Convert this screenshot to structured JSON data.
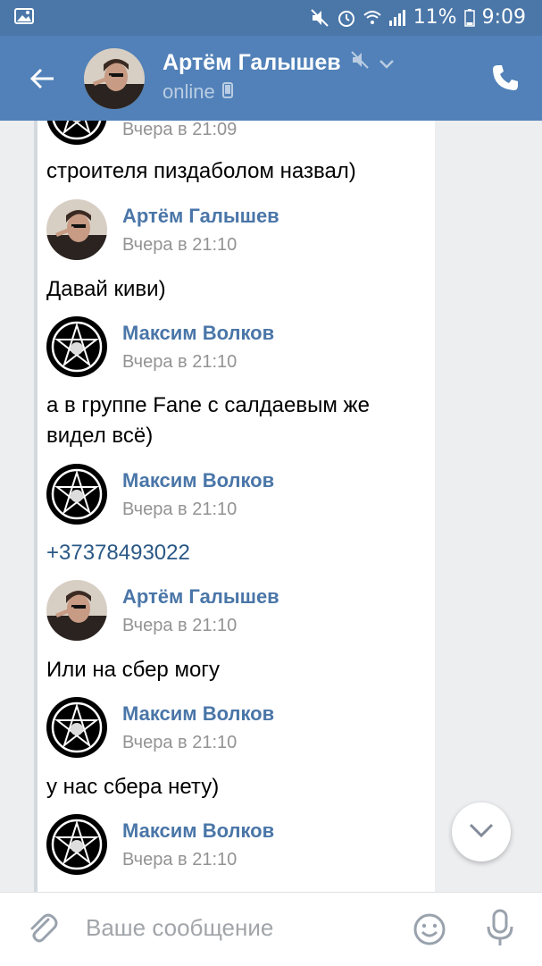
{
  "status_bar": {
    "battery": "11%",
    "time": "9:09"
  },
  "header": {
    "contact_name": "Артём Галышев",
    "status": "online"
  },
  "messages": [
    {
      "type": "time_only",
      "time": "Вчера в 21:09"
    },
    {
      "type": "text",
      "text": "строителя пиздаболом назвал)"
    },
    {
      "type": "author",
      "name": "Артём Галышев",
      "time": "Вчера в 21:10",
      "avatar": "artem"
    },
    {
      "type": "text",
      "text": "Давай киви)"
    },
    {
      "type": "author",
      "name": "Максим Волков",
      "time": "Вчера в 21:10",
      "avatar": "maxim"
    },
    {
      "type": "text",
      "text": "а в группе Fane с салдаевым же видел всё)"
    },
    {
      "type": "author",
      "name": "Максим Волков",
      "time": "Вчера в 21:10",
      "avatar": "maxim"
    },
    {
      "type": "link",
      "text": "+37378493022"
    },
    {
      "type": "author",
      "name": "Артём Галышев",
      "time": "Вчера в 21:10",
      "avatar": "artem"
    },
    {
      "type": "text",
      "text": "Или на сбер могу"
    },
    {
      "type": "author",
      "name": "Максим Волков",
      "time": "Вчера в 21:10",
      "avatar": "maxim"
    },
    {
      "type": "text",
      "text": "у нас сбера нету)"
    },
    {
      "type": "author",
      "name": "Максим Волков",
      "time": "Вчера в 21:10",
      "avatar": "maxim"
    }
  ],
  "composer": {
    "placeholder": "Ваше сообщение"
  },
  "icons": {
    "status_left": "image-icon",
    "back": "back-arrow-icon",
    "mute": "muted-speaker-icon",
    "chevron": "chevron-down-icon",
    "device": "mobile-device-icon",
    "call": "phone-icon",
    "scroll_down": "chevron-down-icon",
    "attach": "paperclip-icon",
    "emoji": "smile-icon",
    "voice": "microphone-icon"
  },
  "colors": {
    "header": "#5181b8",
    "status_bar": "#4a76a8",
    "author_name": "#4a76a8",
    "link": "#2a5885",
    "time": "#939393"
  }
}
